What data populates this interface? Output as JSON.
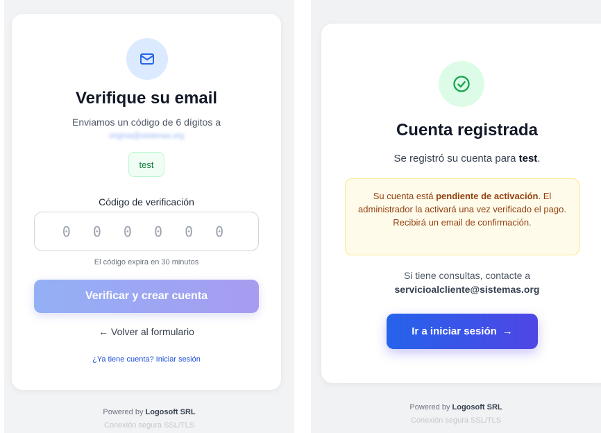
{
  "left": {
    "icon": "envelope-icon",
    "title": "Verifique su email",
    "sent_text": "Enviamos un código de 6 dígitos a",
    "email_redacted": "virginia@sistemas.org",
    "user_badge": "test",
    "code_label": "Código de verificación",
    "code_placeholder": "0 0 0 0 0 0",
    "expire_text": "El código expira en 30 minutos",
    "verify_button": "Verificar y crear cuenta",
    "back_link": "← Volver al formulario",
    "login_link": "¿Ya tiene cuenta? Iniciar sesión",
    "footer_powered": "Powered by",
    "footer_brand": "Logosoft SRL",
    "footer_secure": "Conexión segura SSL/TLS"
  },
  "right": {
    "icon": "check-circle-icon",
    "title": "Cuenta registrada",
    "reg_prefix": "Se registró su cuenta para",
    "reg_user": "test",
    "reg_suffix": ".",
    "notice_prefix": "Su cuenta está",
    "notice_bold": "pendiente de activación",
    "notice_rest": ". El administrador la activará una vez verificado el pago. Recibirá un email de confirmación.",
    "contact_text": "Si tiene consultas, contacte a",
    "contact_email": "servicioalcliente@sistemas.org",
    "signin_button": "Ir a iniciar sesión",
    "signin_arrow": "→",
    "footer_powered": "Powered by",
    "footer_brand": "Logosoft SRL",
    "footer_secure": "Conexión segura SSL/TLS"
  },
  "colors": {
    "primary_blue": "#2563eb",
    "indigo": "#4f46e5",
    "success_green": "#15803d",
    "warning_amber": "#92400e"
  }
}
